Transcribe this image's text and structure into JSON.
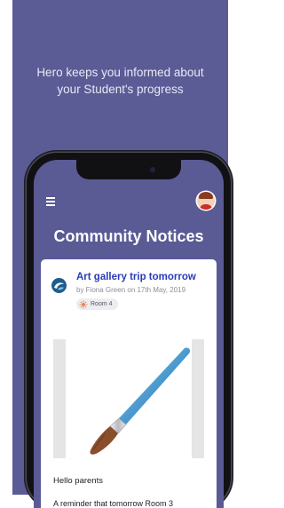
{
  "hero": {
    "line1": "Hero keeps you informed about",
    "line2": "your Student's progress"
  },
  "app": {
    "page_title": "Community Notices",
    "menu_icon": "hamburger-menu-icon",
    "avatar_icon": "user-avatar"
  },
  "notice": {
    "title": "Art gallery trip tomorrow",
    "byline": "by Fiona Green on 17th May, 2019",
    "room_label": "Room 4",
    "image_icon": "paintbrush-image",
    "greeting": "Hello parents",
    "body_preview": "A reminder that tomorrow Room 3"
  },
  "colors": {
    "brand_purple": "#5b5b96",
    "title_blue": "#2b3bb8"
  }
}
